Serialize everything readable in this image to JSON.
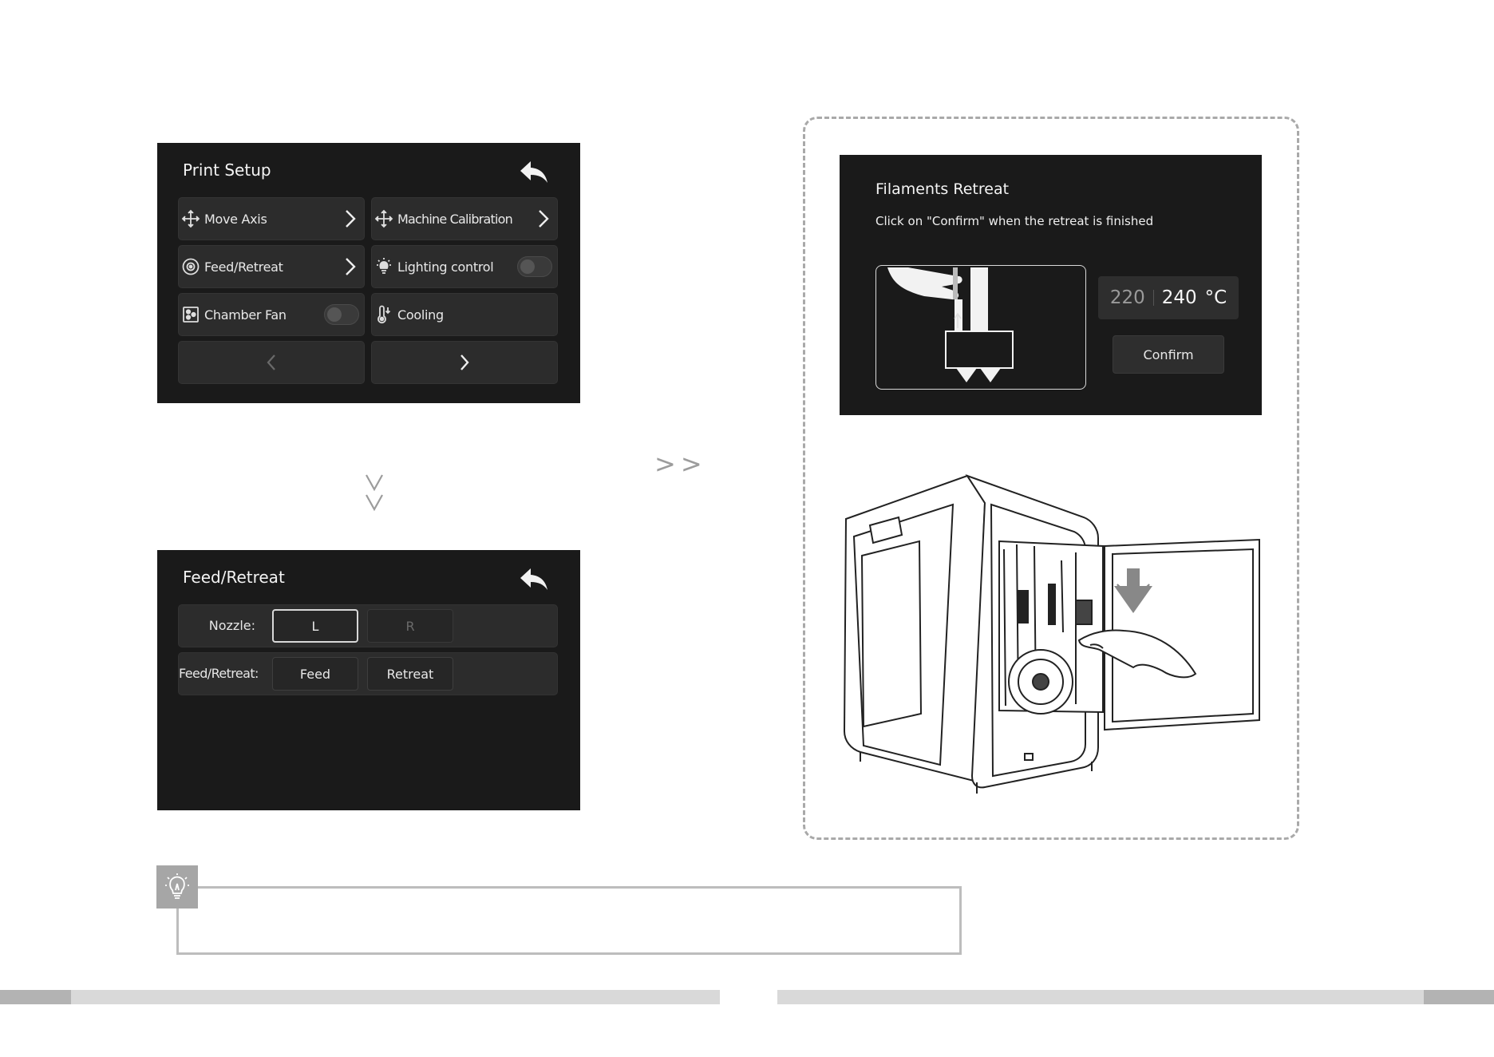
{
  "print_setup": {
    "title": "Print Setup",
    "items": [
      {
        "label": "Move Axis"
      },
      {
        "label": "Machine Calibration"
      },
      {
        "label": "Feed/Retreat"
      },
      {
        "label": "Lighting control"
      },
      {
        "label": "Chamber Fan"
      },
      {
        "label": "Cooling"
      }
    ]
  },
  "feed_retreat": {
    "title": "Feed/Retreat",
    "nozzle_label": "Nozzle:",
    "nozzle_l": "L",
    "nozzle_r": "R",
    "mode_label": "Feed/Retreat:",
    "feed": "Feed",
    "retreat": "Retreat"
  },
  "filaments_retreat": {
    "title": "Filaments Retreat",
    "subtitle": "Click on \"Confirm\" when the retreat is finished",
    "temp_current": "220",
    "temp_target": "240",
    "temp_unit": "°C",
    "confirm": "Confirm"
  },
  "arrows": {
    "right": ">>"
  },
  "colors": {
    "screen_bg": "#1a1a1a",
    "tile_bg": "#2c2c2c",
    "dash_border": "#a9a9a9",
    "tip_icon_bg": "#a6a6a6"
  }
}
